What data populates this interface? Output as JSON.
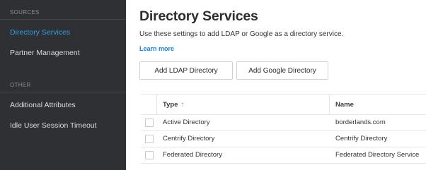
{
  "sidebar": {
    "sources_header": "SOURCES",
    "other_header": "OTHER",
    "items": [
      {
        "label": "Directory Services",
        "active": true
      },
      {
        "label": "Partner Management",
        "active": false
      },
      {
        "label": "Additional Attributes",
        "active": false
      },
      {
        "label": "Idle User Session Timeout",
        "active": false
      }
    ]
  },
  "main": {
    "title": "Directory Services",
    "description": "Use these settings to add LDAP or Google as a directory service.",
    "learn_more": "Learn more",
    "buttons": {
      "add_ldap": "Add LDAP Directory",
      "add_google": "Add Google Directory"
    },
    "table": {
      "headers": {
        "type": "Type",
        "name": "Name",
        "sort_arrow": "↑"
      },
      "rows": [
        {
          "type": "Active Directory",
          "name": "borderlands.com"
        },
        {
          "type": "Centrify Directory",
          "name": "Centrify Directory"
        },
        {
          "type": "Federated Directory",
          "name": "Federated Directory Service"
        }
      ]
    }
  },
  "colors": {
    "sidebar_bg": "#2f3033",
    "active_item": "#2f9ee8",
    "link": "#1b82d1"
  }
}
